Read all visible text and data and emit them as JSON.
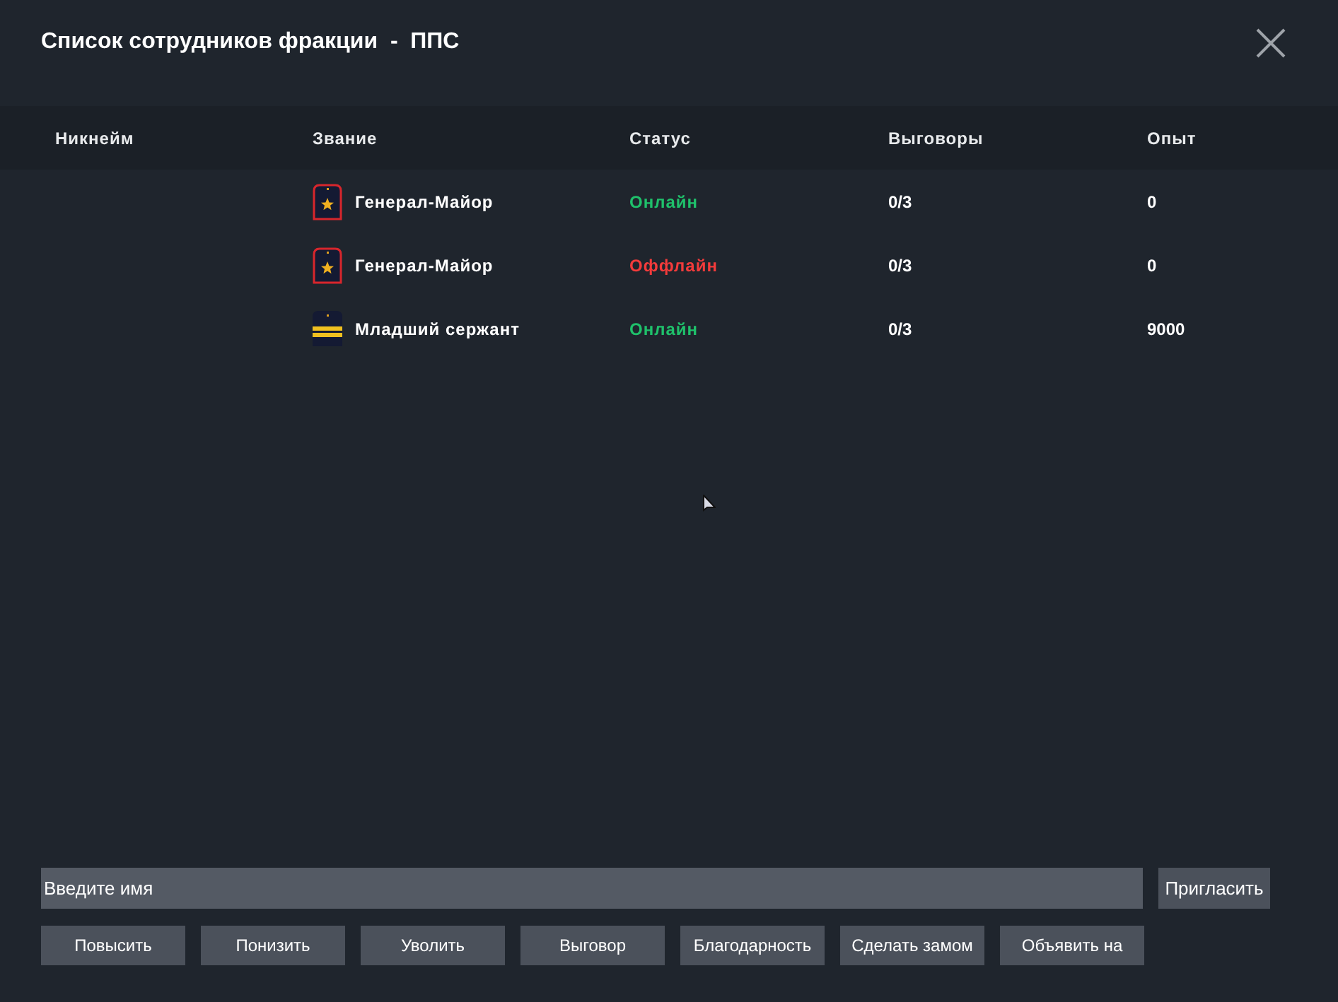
{
  "window": {
    "title": "Список сотрудников фракции  -  ППС"
  },
  "table": {
    "columns": [
      "Никнейм",
      "Звание",
      "Статус",
      "Выговоры",
      "Опыт"
    ],
    "rows": [
      {
        "rank": {
          "text": "Генерал-Майор",
          "kind": "star"
        },
        "status": {
          "text": "Онлайн",
          "online": true
        },
        "reprimands": "0/3",
        "experience": "0"
      },
      {
        "rank": {
          "text": "Генерал-Майор",
          "kind": "star"
        },
        "status": {
          "text": "Оффлайн",
          "online": false
        },
        "reprimands": "0/3",
        "experience": "0"
      },
      {
        "rank": {
          "text": "Младший сержант",
          "kind": "stripes"
        },
        "status": {
          "text": "Онлайн",
          "online": true
        },
        "reprimands": "0/3",
        "experience": "9000"
      }
    ]
  },
  "search": {
    "placeholder": "Введите имя"
  },
  "invite_button": "Пригласить",
  "buttons": [
    "Повысить",
    "Понизить",
    "Уволить",
    "Выговор",
    "Благодарность",
    "Сделать замом",
    "Объявить на"
  ]
}
